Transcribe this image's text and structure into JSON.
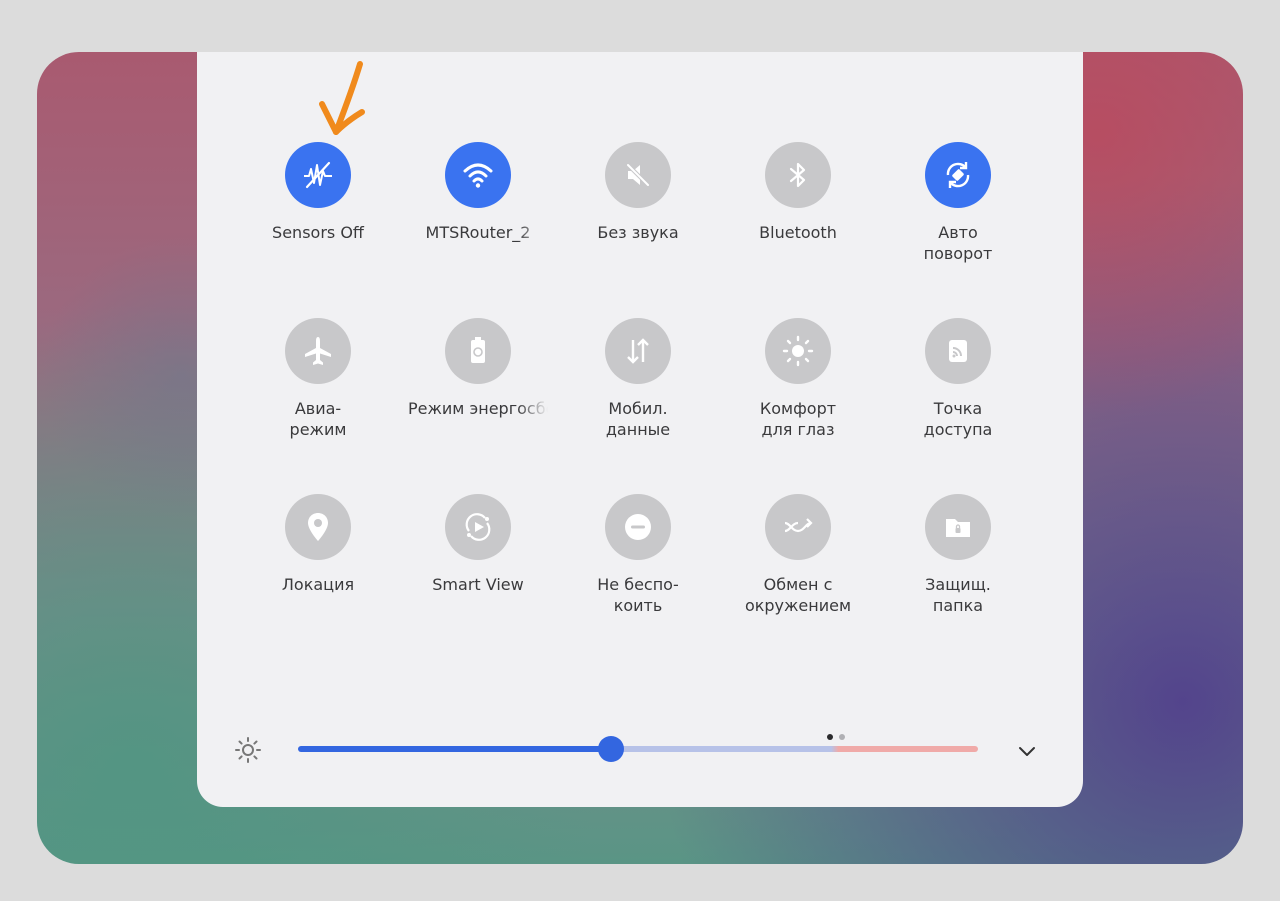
{
  "tiles": [
    {
      "label": "Sensors Off",
      "icon": "sensors-off-icon",
      "on": true
    },
    {
      "label": "MTSRouter_2",
      "icon": "wifi-icon",
      "on": true,
      "clip": true
    },
    {
      "label": "Без звука",
      "icon": "mute-icon",
      "on": false
    },
    {
      "label": "Bluetooth",
      "icon": "bluetooth-icon",
      "on": false
    },
    {
      "label": "Авто\nповорот",
      "icon": "auto-rotate-icon",
      "on": true
    },
    {
      "label": "Авиа-\nрежим",
      "icon": "airplane-icon",
      "on": false
    },
    {
      "label": "Режим энергосбережения",
      "icon": "power-saving-icon",
      "on": false,
      "clip": true
    },
    {
      "label": "Мобил.\nданные",
      "icon": "mobile-data-icon",
      "on": false
    },
    {
      "label": "Комфорт\nдля глаз",
      "icon": "eye-comfort-icon",
      "on": false
    },
    {
      "label": "Точка\nдоступа",
      "icon": "hotspot-icon",
      "on": false
    },
    {
      "label": "Локация",
      "icon": "location-icon",
      "on": false
    },
    {
      "label": "Smart View",
      "icon": "smart-view-icon",
      "on": false
    },
    {
      "label": "Не беспо-\nкоить",
      "icon": "do-not-disturb-icon",
      "on": false
    },
    {
      "label": "Обмен с\nокружением",
      "icon": "nearby-share-icon",
      "on": false
    },
    {
      "label": "Защищ.\nпапка",
      "icon": "secure-folder-icon",
      "on": false
    }
  ],
  "pages": {
    "count": 2,
    "current": 1
  },
  "brightness": {
    "level": 0.46
  },
  "colors": {
    "accent": "#3a73f0",
    "inactive": "#c8c8ca",
    "annotation": "#f08a1c"
  }
}
